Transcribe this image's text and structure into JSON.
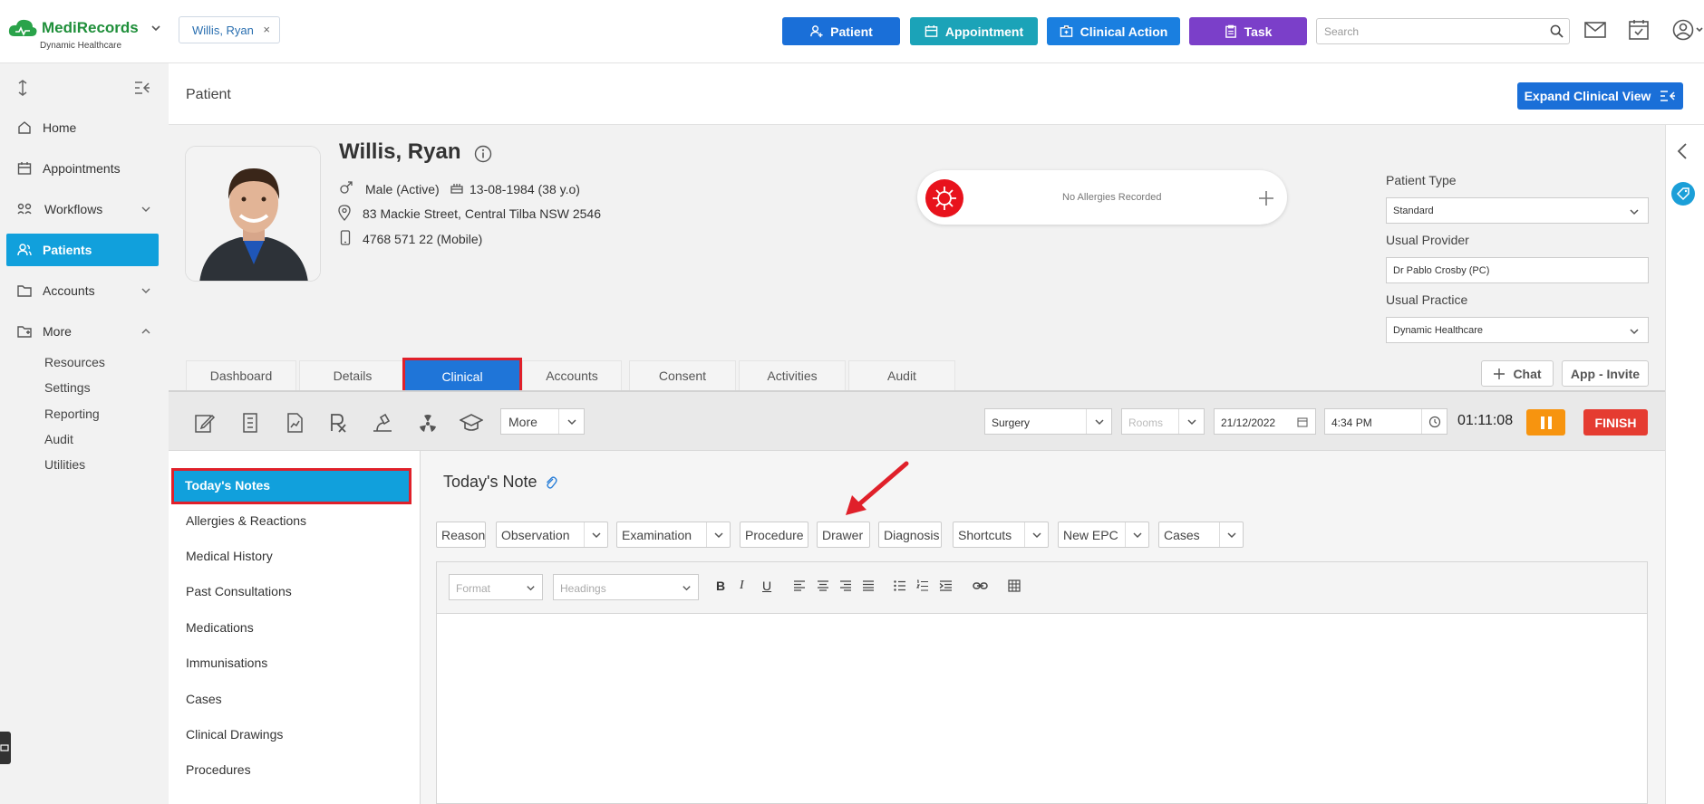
{
  "app": {
    "logo_text": "MediRecords",
    "logo_sub": "Dynamic Healthcare"
  },
  "topbar": {
    "patient_chip": "Willis, Ryan",
    "buttons": [
      {
        "label": "Patient",
        "color": "#1a6fd8"
      },
      {
        "label": "Appointment",
        "color": "#1ba3b8"
      },
      {
        "label": "Clinical Action",
        "color": "#1a7fe0"
      },
      {
        "label": "Task",
        "color": "#7b3fc9"
      }
    ],
    "search_placeholder": "Search"
  },
  "sidebar": {
    "items": [
      {
        "label": "Home",
        "icon": "home-icon"
      },
      {
        "label": "Appointments",
        "icon": "calendar-icon"
      },
      {
        "label": "Workflows",
        "icon": "workflow-icon"
      },
      {
        "label": "Patients",
        "icon": "users-icon",
        "active": true
      },
      {
        "label": "Accounts",
        "icon": "folder-icon"
      },
      {
        "label": "More",
        "icon": "folder-plus-icon"
      }
    ],
    "more_items": [
      "Resources",
      "Settings",
      "Reporting",
      "Audit",
      "Utilities"
    ]
  },
  "page": {
    "title": "Patient",
    "expand_button": "Expand Clinical View"
  },
  "patient": {
    "name": "Willis, Ryan",
    "gender": "Male (Active)",
    "dob": "13-08-1984 (38 y.o)",
    "address": "83 Mackie Street, Central Tilba NSW 2546",
    "phone": "4768 571 22 (Mobile)",
    "allergies": "No Allergies Recorded"
  },
  "right_panel": {
    "patient_type_label": "Patient Type",
    "patient_type": "Standard",
    "usual_provider_label": "Usual Provider",
    "usual_provider": "Dr Pablo Crosby (PC)",
    "usual_practice_label": "Usual Practice",
    "usual_practice": "Dynamic Healthcare"
  },
  "tabs": [
    "Dashboard",
    "Details",
    "Clinical",
    "Accounts",
    "Consent",
    "Activities",
    "Audit"
  ],
  "tab_actions": {
    "chat": "Chat",
    "app_invite": "App - Invite"
  },
  "toolbar": {
    "more": "More",
    "location": "Surgery",
    "rooms_placeholder": "Rooms",
    "date": "21/12/2022",
    "time": "4:34 PM",
    "timer": "01:11:08",
    "finish": "FINISH"
  },
  "clinical_menu": {
    "active": "Today's Notes",
    "items": [
      "Allergies & Reactions",
      "Medical History",
      "Past Consultations",
      "Medications",
      "Immunisations",
      "Cases",
      "Clinical Drawings",
      "Procedures"
    ]
  },
  "note": {
    "title": "Today's Note",
    "buttons": [
      "Reason",
      "Observation",
      "Examination",
      "Procedure",
      "Drawer",
      "Diagnosis",
      "Shortcuts",
      "New EPC",
      "Cases"
    ],
    "format_placeholder": "Format",
    "headings_placeholder": "Headings"
  }
}
